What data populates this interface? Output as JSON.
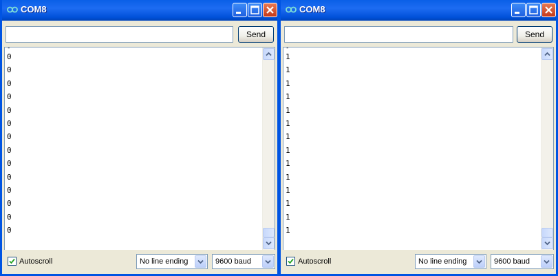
{
  "windows": [
    {
      "title": "COM8",
      "send_label": "Send",
      "input_value": "",
      "lines": [
        "0",
        "0",
        "0",
        "0",
        "0",
        "0",
        "0",
        "0",
        "0",
        "0",
        "0",
        "0",
        "0",
        "0"
      ],
      "autoscroll_label": "Autoscroll",
      "autoscroll_checked": true,
      "line_ending": "No line ending",
      "baud": "9600 baud"
    },
    {
      "title": "COM8",
      "send_label": "Send",
      "input_value": "",
      "lines": [
        "1",
        "1",
        "1",
        "1",
        "1",
        "1",
        "1",
        "1",
        "1",
        "1",
        "1",
        "1",
        "1",
        "1"
      ],
      "autoscroll_label": "Autoscroll",
      "autoscroll_checked": true,
      "line_ending": "No line ending",
      "baud": "9600 baud"
    }
  ],
  "icons": {
    "app": "arduino-infinity-icon",
    "minimize": "minimize-icon",
    "maximize": "maximize-icon",
    "close": "close-icon",
    "scroll_up": "chevron-up-icon",
    "scroll_down": "chevron-down-icon",
    "dropdown": "chevron-down-icon",
    "check": "check-icon"
  },
  "colors": {
    "titlebar": "#0054e3",
    "close_button": "#d9532c",
    "window_bg": "#ece9d8",
    "field_border": "#7f9db9"
  }
}
